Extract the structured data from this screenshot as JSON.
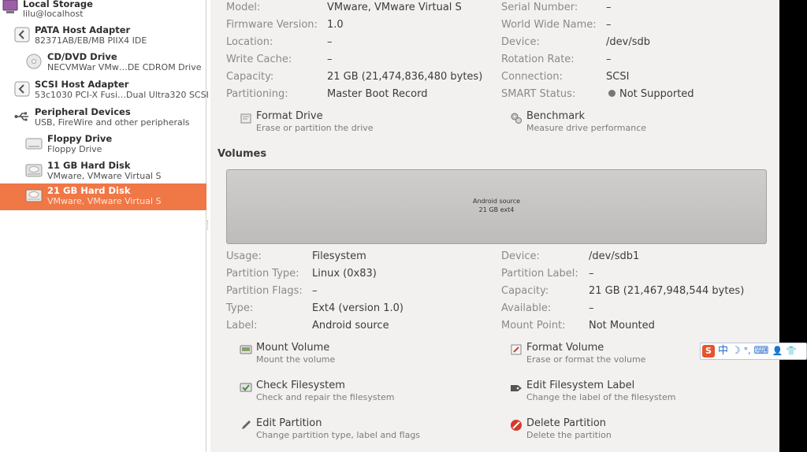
{
  "sidebar": {
    "items": [
      {
        "title": "Local Storage",
        "subtitle": "lilu@localhost"
      },
      {
        "title": "PATA Host Adapter",
        "subtitle": "82371AB/EB/MB PIIX4 IDE"
      },
      {
        "title": "CD/DVD Drive",
        "subtitle": "NECVMWar VMw…DE CDROM Drive"
      },
      {
        "title": "SCSI Host Adapter",
        "subtitle": "53c1030 PCI-X Fusi…Dual Ultra320 SCSI"
      },
      {
        "title": "Peripheral Devices",
        "subtitle": "USB, FireWire and other peripherals"
      },
      {
        "title": "Floppy Drive",
        "subtitle": "Floppy Drive"
      },
      {
        "title": "11 GB Hard Disk",
        "subtitle": "VMware, VMware Virtual S"
      },
      {
        "title": "21 GB Hard Disk",
        "subtitle": "VMware, VMware Virtual S"
      }
    ]
  },
  "drive": {
    "left": [
      {
        "label": "Model:",
        "value": "VMware, VMware Virtual S"
      },
      {
        "label": "Firmware Version:",
        "value": "1.0"
      },
      {
        "label": "Location:",
        "value": "–"
      },
      {
        "label": "Write Cache:",
        "value": "–"
      },
      {
        "label": "Capacity:",
        "value": "21 GB (21,474,836,480 bytes)"
      },
      {
        "label": "Partitioning:",
        "value": "Master Boot Record"
      }
    ],
    "right": [
      {
        "label": "Serial Number:",
        "value": "–"
      },
      {
        "label": "World Wide Name:",
        "value": "–"
      },
      {
        "label": "Device:",
        "value": "/dev/sdb"
      },
      {
        "label": "Rotation Rate:",
        "value": "–"
      },
      {
        "label": "Connection:",
        "value": "SCSI"
      },
      {
        "label": "SMART Status:",
        "value": "Not Supported"
      }
    ],
    "actions": {
      "format": {
        "title": "Format Drive",
        "subtitle": "Erase or partition the drive"
      },
      "benchmark": {
        "title": "Benchmark",
        "subtitle": "Measure drive performance"
      }
    }
  },
  "volumes": {
    "title": "Volumes",
    "bar": {
      "name": "Android  source",
      "detail": "21 GB ext4"
    },
    "left": [
      {
        "label": "Usage:",
        "value": "Filesystem"
      },
      {
        "label": "Partition Type:",
        "value": "Linux (0x83)"
      },
      {
        "label": "Partition Flags:",
        "value": "–"
      },
      {
        "label": "Type:",
        "value": "Ext4 (version 1.0)"
      },
      {
        "label": "Label:",
        "value": "Android  source"
      }
    ],
    "right": [
      {
        "label": "Device:",
        "value": "/dev/sdb1"
      },
      {
        "label": "Partition Label:",
        "value": "–"
      },
      {
        "label": "Capacity:",
        "value": "21 GB (21,467,948,544 bytes)"
      },
      {
        "label": "Available:",
        "value": "–"
      },
      {
        "label": "Mount Point:",
        "value": "Not Mounted"
      }
    ],
    "actions": {
      "mount": {
        "title": "Mount Volume",
        "subtitle": "Mount the volume"
      },
      "format_volume": {
        "title": "Format Volume",
        "subtitle": "Erase or format the volume"
      },
      "check": {
        "title": "Check Filesystem",
        "subtitle": "Check and repair the filesystem"
      },
      "edit_label": {
        "title": "Edit Filesystem Label",
        "subtitle": "Change the label of the filesystem"
      },
      "edit_partition": {
        "title": "Edit Partition",
        "subtitle": "Change partition type, label and flags"
      },
      "delete_partition": {
        "title": "Delete Partition",
        "subtitle": "Delete the partition"
      }
    }
  },
  "ime": {
    "logo": "S",
    "mode": "中",
    "moon": "☽",
    "punct": "°,",
    "keyboard": "⌨",
    "person": "👤",
    "shirt": "👕"
  },
  "colors": {
    "selection": "#f07746",
    "panel": "#f2f1f0",
    "sidebar": "#ffffff",
    "delete": "#d63a2a"
  }
}
